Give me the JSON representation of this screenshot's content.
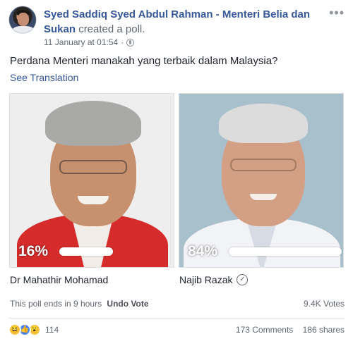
{
  "post": {
    "author": "Syed Saddiq Syed Abdul Rahman - Menteri Belia dan Sukan",
    "action": "created a poll.",
    "timestamp": "11 January at 01:54",
    "privacy_icon": "globe-icon",
    "more_icon": "more-options-icon",
    "more_label": "•••"
  },
  "poll": {
    "question": "Perdana Menteri manakah yang terbaik dalam Malaysia?",
    "see_translation": "See Translation",
    "options": [
      {
        "name": "Dr Mahathir Mohamad",
        "percent_label": "16%",
        "percent": 16,
        "voted": false
      },
      {
        "name": "Najib Razak",
        "percent_label": "84%",
        "percent": 84,
        "voted": true,
        "check_mark": "✓"
      }
    ],
    "ends_text": "This poll ends in 9 hours",
    "undo_label": "Undo Vote",
    "votes_label": "9.4K Votes"
  },
  "engagement": {
    "reaction_icons": [
      "haha-reaction-icon",
      "like-reaction-icon",
      "wow-reaction-icon"
    ],
    "reactions_count": "114",
    "comments_label": "173 Comments",
    "shares_label": "186 shares"
  },
  "colors": {
    "link_blue": "#365899",
    "meta_gray": "#616770",
    "like_blue": "#4a86f7",
    "reaction_yellow": "#f7c33f"
  }
}
